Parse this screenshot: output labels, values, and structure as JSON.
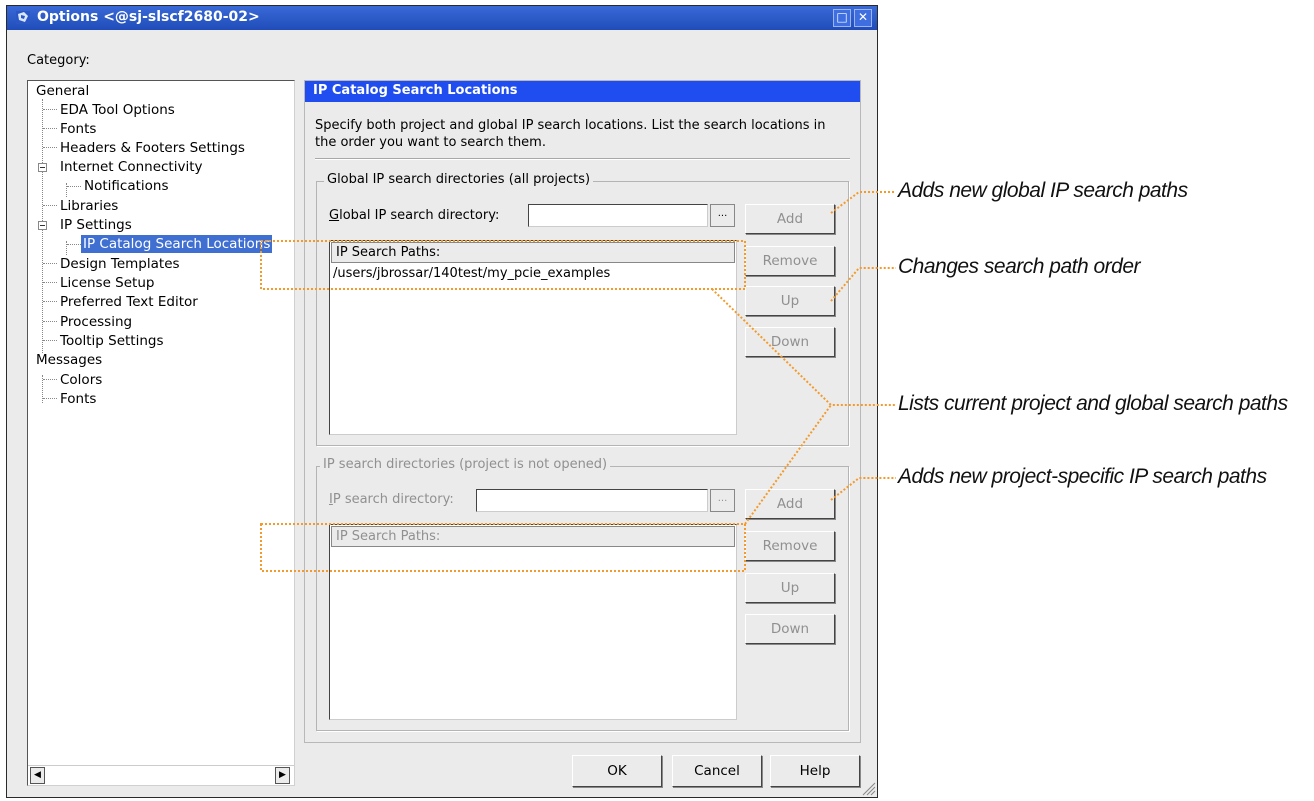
{
  "window": {
    "title": "Options <@sj-slscf2680-02>",
    "controls": [
      "□",
      "✕"
    ]
  },
  "category_label": "Category:",
  "tree": {
    "items": [
      {
        "label": "General"
      },
      {
        "label": "EDA Tool Options"
      },
      {
        "label": "Fonts"
      },
      {
        "label": "Headers & Footers Settings"
      },
      {
        "label": "Internet Connectivity"
      },
      {
        "label": "Notifications"
      },
      {
        "label": "Libraries"
      },
      {
        "label": "IP Settings"
      },
      {
        "label": "IP Catalog Search Locations",
        "selected": true
      },
      {
        "label": "Design Templates"
      },
      {
        "label": "License Setup"
      },
      {
        "label": "Preferred Text Editor"
      },
      {
        "label": "Processing"
      },
      {
        "label": "Tooltip Settings"
      },
      {
        "label": "Messages"
      },
      {
        "label": "Colors"
      },
      {
        "label": "Fonts"
      }
    ],
    "scroll_left": "◀",
    "scroll_right": "▶"
  },
  "panel": {
    "header": "IP Catalog Search Locations",
    "description": "Specify both project and global IP search locations. List the search locations in the order you want to search them."
  },
  "global_group": {
    "title": "Global IP search directories (all projects)",
    "dir_label": "Global IP search directory:",
    "dir_label_mnemonic": "G",
    "dir_label_rest": "lobal IP search directory:",
    "dir_value": "",
    "browse": "...",
    "list_header": "IP Search Paths:",
    "paths": [
      "/users/jbrossar/140test/my_pcie_examples"
    ],
    "buttons": {
      "add": "Add",
      "remove": "Remove",
      "up": "Up",
      "down": "Down"
    }
  },
  "project_group": {
    "title": "IP search directories (project is not opened)",
    "dir_label_mnemonic": "I",
    "dir_label_rest": "P search directory:",
    "dir_value": "",
    "browse": "...",
    "list_header": "IP Search Paths:",
    "buttons": {
      "add": "Add",
      "remove": "Remove",
      "up": "Up",
      "down": "Down"
    }
  },
  "footer": {
    "ok": "OK",
    "cancel": "Cancel",
    "help": "Help"
  },
  "annotations": {
    "add_global": "Adds new global IP search paths",
    "order": "Changes search path order",
    "lists": "Lists current project and global search paths",
    "add_project": "Adds new project-specific IP search paths"
  },
  "colors": {
    "callout": "#f39a2a",
    "title_bar": "#2a56c6",
    "panel_header": "#1f4df0",
    "selection": "#3f6fd0"
  }
}
